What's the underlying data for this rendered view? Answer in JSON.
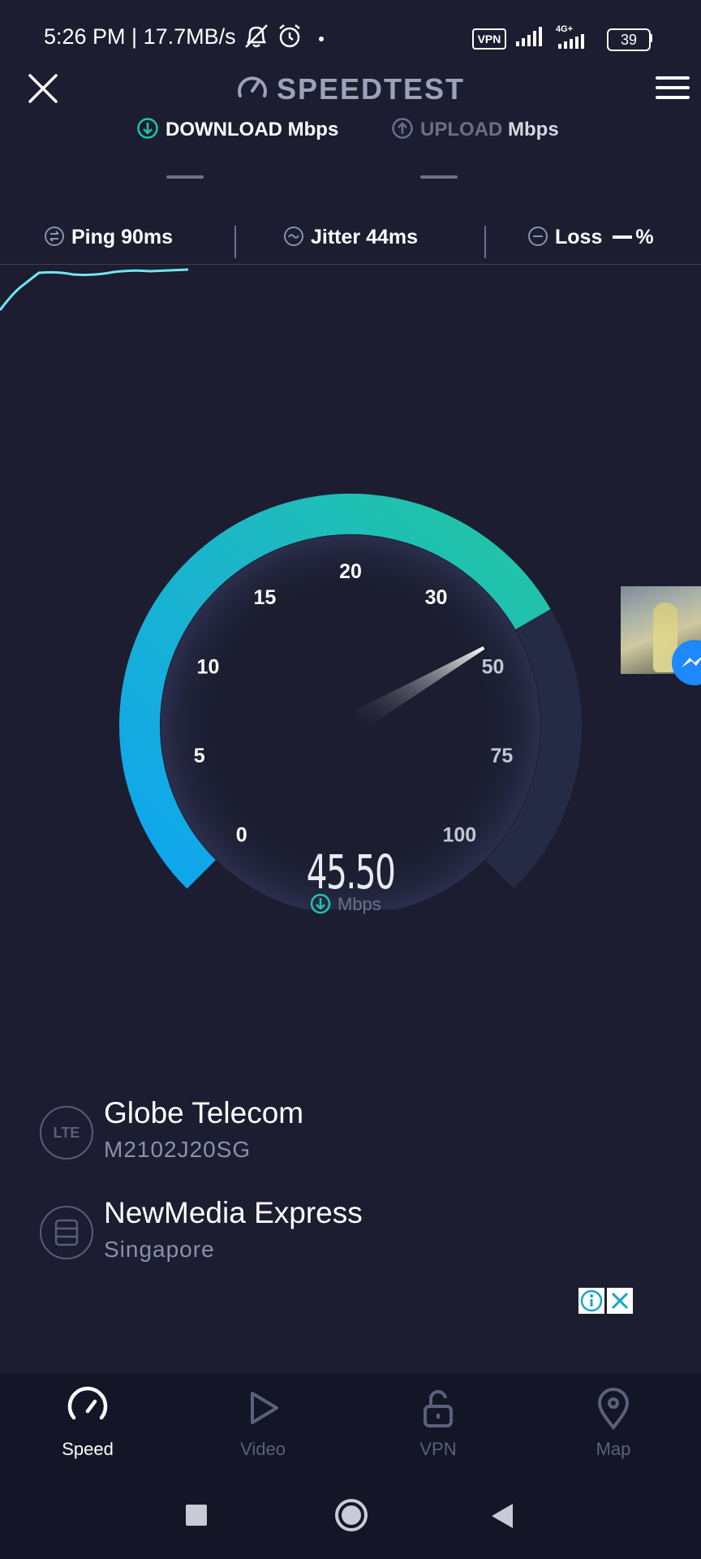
{
  "status_bar": {
    "time_text": "5:26 PM | 17.7MB/s",
    "vpn_badge": "VPN",
    "network_type": "4G+",
    "battery": "39"
  },
  "header": {
    "title": "SPEEDTEST",
    "download_label": "DOWNLOAD",
    "download_unit": "Mbps",
    "upload_label": "UPLOAD",
    "upload_unit": "Mbps"
  },
  "metrics": {
    "ping_label": "Ping",
    "ping_value": "90ms",
    "jitter_label": "Jitter",
    "jitter_value": "44ms",
    "loss_label": "Loss",
    "loss_unit": "%"
  },
  "gauge": {
    "ticks": [
      "0",
      "5",
      "10",
      "15",
      "20",
      "30",
      "50",
      "75",
      "100"
    ],
    "value": "45.50",
    "unit": "Mbps",
    "needle_value": 45.5
  },
  "provider": {
    "icon_text": "LTE",
    "isp": "Globe Telecom",
    "device": "M2102J20SG"
  },
  "server": {
    "name": "NewMedia Express",
    "location": "Singapore"
  },
  "nav": {
    "items": [
      {
        "label": "Speed",
        "icon": "speedometer-icon",
        "active": true
      },
      {
        "label": "Video",
        "icon": "play-icon",
        "active": false
      },
      {
        "label": "VPN",
        "icon": "unlock-icon",
        "active": false
      },
      {
        "label": "Map",
        "icon": "map-pin-icon",
        "active": false
      }
    ]
  },
  "colors": {
    "background": "#1c1d30",
    "accent_teal": "#20c4a8",
    "accent_blue": "#14a8ee",
    "nav_bg": "#141526"
  }
}
